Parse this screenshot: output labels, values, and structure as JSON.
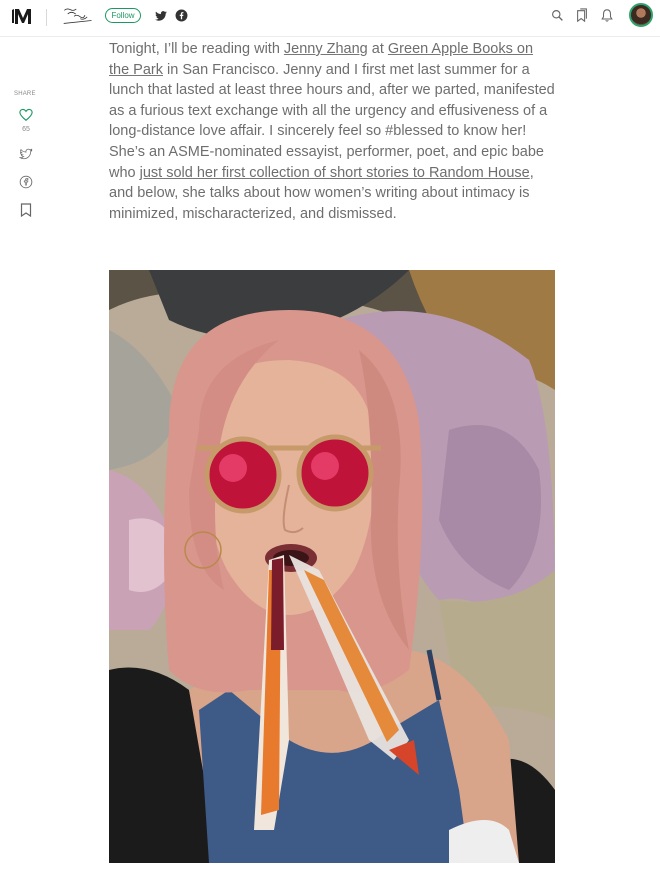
{
  "topbar": {
    "follow_label": "Follow",
    "icons": [
      "medium-logo-icon",
      "twitter-icon",
      "facebook-icon",
      "search-icon",
      "bookmarks-icon",
      "bell-icon"
    ]
  },
  "share": {
    "label": "SHARE",
    "count": "65"
  },
  "article": {
    "segments": [
      {
        "text": "Tonight, I’ll be reading with ",
        "link": false
      },
      {
        "text": "Jenny Zhang",
        "link": true
      },
      {
        "text": " at ",
        "link": false
      },
      {
        "text": "Green Apple Books on the Park",
        "link": true
      },
      {
        "text": " in San Francisco. Jenny and I first met last summer for a lunch that lasted at least three hours and, after we parted, manifested as a furious text exchange with all the urgency and effusiveness of a long-distance love affair. I sincerely feel so #blessed to know her! She’s an ASME-nominated essayist, performer, poet, and epic babe who ",
        "link": false
      },
      {
        "text": "just sold her first collection of short stories to Random House",
        "link": true
      },
      {
        "text": ", and below, she talks about how women’s writing about intimacy is minimized, mischaracterized, and dismissed.",
        "link": false
      }
    ]
  },
  "colors": {
    "accent": "#1c9963",
    "body_text": "#6e6e6e"
  }
}
